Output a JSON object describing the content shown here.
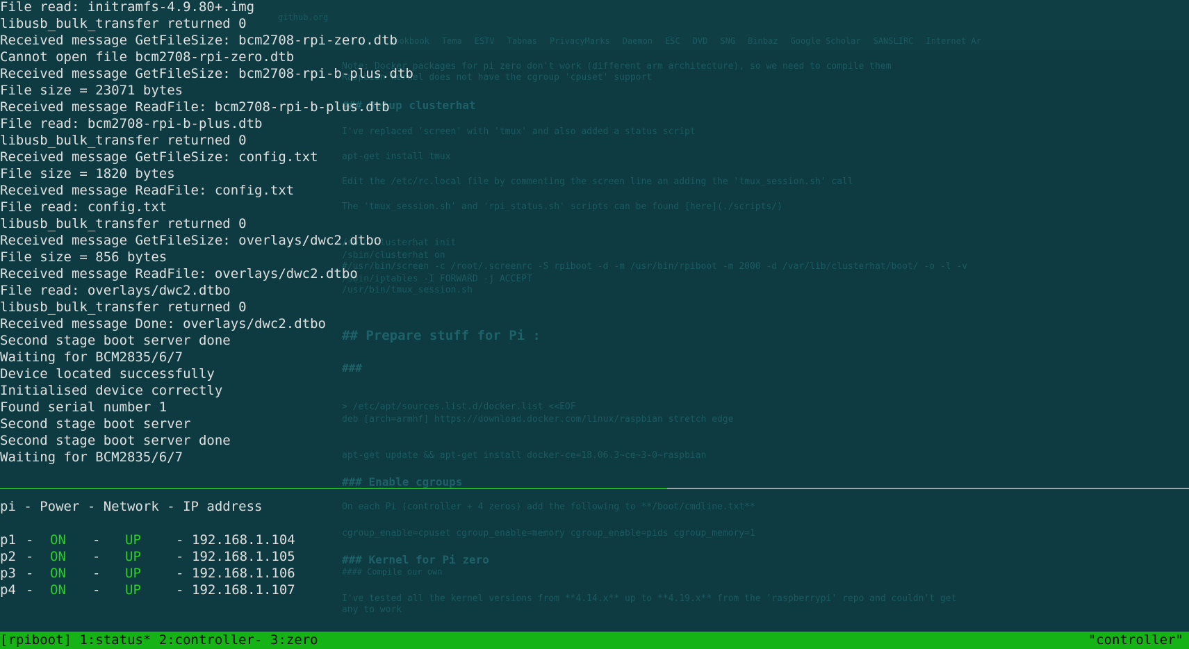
{
  "background_doc": {
    "tab_label": "",
    "url_text": "github.org",
    "bookmarks": [
      "Cookbook",
      "Tema",
      "ESTV",
      "Tabnas",
      "PrivacyMarks",
      "Daemon",
      "ESC",
      "DVD",
      "SNG",
      "Binbaz",
      "Google Scholar",
      "SANSLIRC",
      "Internet Ar"
    ],
    "lines": [
      "Note: Docker packages for pi zero don't work (different arm architecture), so we need to compile them",
      "Raspbian kernel does not have the cgroup 'cpuset' support",
      "### Setup clusterhat",
      "I've replaced 'screen' with 'tmux' and also added a status script",
      "apt-get install tmux",
      "Edit the /etc/rc.local file by commenting the screen line an adding the 'tmux_session.sh' call",
      "The 'tmux_session.sh' and 'rpi_status.sh' scripts can be found [here](./scripts/)",
      "/sbin/clusterhat init",
      "/sbin/clusterhat on",
      "#/usr/bin/screen -c /root/.screenrc -S rpiboot -d -m /usr/bin/rpiboot -m 2000 -d /var/lib/clusterhat/boot/ -o -l -v",
      "/sbin/iptables -I FORWARD -j ACCEPT",
      "/usr/bin/tmux_session.sh",
      "## Prepare stuff for Pi :",
      "###",
      "> /etc/apt/sources.list.d/docker.list <<EOF",
      "deb [arch=armhf] https://download.docker.com/linux/raspbian stretch edge",
      "apt-get update && apt-get install docker-ce=18.06.3~ce~3-0~raspbian",
      "### Enable cgroups",
      "On each Pi (controller + 4 zeros) add the following to **/boot/cmdline.txt**",
      "cgroup_enable=cpuset cgroup_enable=memory cgroup_enable=pids cgroup_memory=1",
      "### Kernel for Pi zero",
      "#### Compile our own",
      "I've tested all the kernel versions from **4.14.x** up to **4.19.x** from the 'raspberrypi' repo and couldn't get",
      "any to work"
    ]
  },
  "terminal": {
    "top_lines": [
      "File read: initramfs-4.9.80+.img",
      "libusb_bulk_transfer returned 0",
      "Received message GetFileSize: bcm2708-rpi-zero.dtb",
      "Cannot open file bcm2708-rpi-zero.dtb",
      "Received message GetFileSize: bcm2708-rpi-b-plus.dtb",
      "File size = 23071 bytes",
      "Received message ReadFile: bcm2708-rpi-b-plus.dtb",
      "File read: bcm2708-rpi-b-plus.dtb",
      "libusb_bulk_transfer returned 0",
      "Received message GetFileSize: config.txt",
      "File size = 1820 bytes",
      "Received message ReadFile: config.txt",
      "File read: config.txt",
      "libusb_bulk_transfer returned 0",
      "Received message GetFileSize: overlays/dwc2.dtbo",
      "File size = 856 bytes",
      "Received message ReadFile: overlays/dwc2.dtbo",
      "File read: overlays/dwc2.dtbo",
      "libusb_bulk_transfer returned 0",
      "Received message Done: overlays/dwc2.dtbo",
      "Second stage boot server done",
      "Waiting for BCM2835/6/7",
      "Device located successfully",
      "Initialised device correctly",
      "Found serial number 1",
      "Second stage boot server",
      "Second stage boot server done",
      "Waiting for BCM2835/6/7"
    ]
  },
  "status_pane": {
    "header": "pi - Power - Network - IP address",
    "sep": "-",
    "rows": [
      {
        "pi": "p1",
        "power": "ON",
        "network": "UP",
        "ip": "192.168.1.104"
      },
      {
        "pi": "p2",
        "power": "ON",
        "network": "UP",
        "ip": "192.168.1.105"
      },
      {
        "pi": "p3",
        "power": "ON",
        "network": "UP",
        "ip": "192.168.1.106"
      },
      {
        "pi": "p4",
        "power": "ON",
        "network": "UP",
        "ip": "192.168.1.107"
      }
    ]
  },
  "tmux": {
    "session": "[rpiboot]",
    "windows": [
      {
        "label": "1:status*"
      },
      {
        "label": "2:controller-"
      },
      {
        "label": "3:zero"
      }
    ],
    "right_label": "\"controller\""
  },
  "colors": {
    "background": "#0d3b41",
    "status_bar": "#16b316",
    "status_green": "#2ecc2e",
    "divider_active": "#21b321"
  }
}
